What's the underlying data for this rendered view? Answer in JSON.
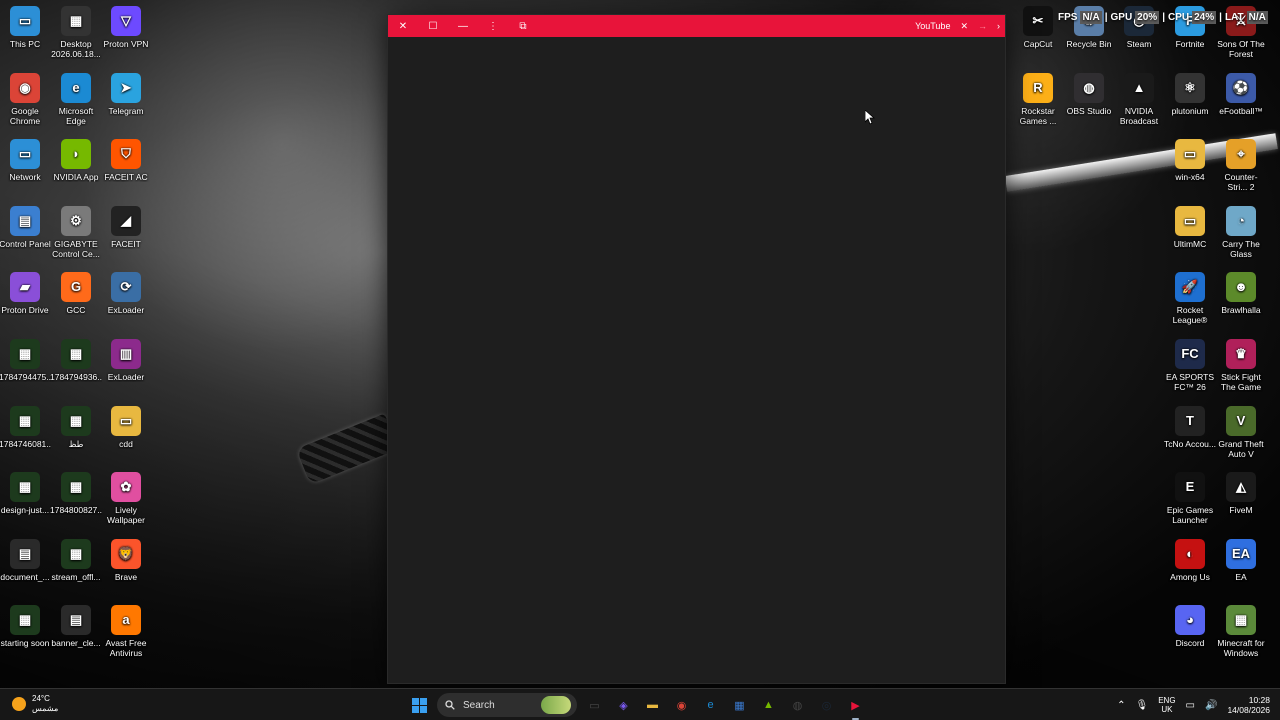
{
  "desktop": {
    "left_icons": [
      {
        "label": "This PC",
        "icon": "this-pc-icon",
        "color": "#2c8fd6",
        "glyph": "▭"
      },
      {
        "label": "Desktop 2026.06.18...",
        "icon": "folder-video-icon",
        "color": "#333333",
        "glyph": "▦"
      },
      {
        "label": "Proton VPN",
        "icon": "proton-vpn-icon",
        "color": "#6d4aff",
        "glyph": "▽"
      },
      {
        "label": "Google Chrome",
        "icon": "chrome-icon",
        "color": "#db4437",
        "glyph": "◉"
      },
      {
        "label": "Microsoft Edge",
        "icon": "edge-icon",
        "color": "#1b8ad3",
        "glyph": "e"
      },
      {
        "label": "Telegram",
        "icon": "telegram-icon",
        "color": "#2aa3df",
        "glyph": "➤"
      },
      {
        "label": "Network",
        "icon": "network-icon",
        "color": "#2c8fd6",
        "glyph": "▭"
      },
      {
        "label": "NVIDIA App",
        "icon": "nvidia-icon",
        "color": "#76b900",
        "glyph": "◗"
      },
      {
        "label": "FACEIT AC",
        "icon": "faceit-ac-icon",
        "color": "#ff5500",
        "glyph": "⛉"
      },
      {
        "label": "Control Panel",
        "icon": "control-panel-icon",
        "color": "#3b7fd0",
        "glyph": "▤"
      },
      {
        "label": "GIGABYTE Control Ce...",
        "icon": "gigabyte-icon",
        "color": "#7a7a7a",
        "glyph": "⚙"
      },
      {
        "label": "FACEIT",
        "icon": "faceit-icon",
        "color": "#222222",
        "glyph": "◢"
      },
      {
        "label": "Proton Drive",
        "icon": "proton-drive-icon",
        "color": "#8a4fd8",
        "glyph": "▰"
      },
      {
        "label": "GCC",
        "icon": "gcc-icon",
        "color": "#ff6a1a",
        "glyph": "G"
      },
      {
        "label": "ExLoader",
        "icon": "exloader-icon",
        "color": "#3a6ea5",
        "glyph": "⟳"
      },
      {
        "label": "1784794475...",
        "icon": "video-thumb-icon",
        "color": "#1d3a1d",
        "glyph": "▦"
      },
      {
        "label": "1784794936...",
        "icon": "video-thumb-icon",
        "color": "#1d3a1d",
        "glyph": "▦"
      },
      {
        "label": "ExLoader",
        "icon": "winrar-icon",
        "color": "#8c2a8c",
        "glyph": "▥"
      },
      {
        "label": "1784746081...",
        "icon": "video-thumb-icon",
        "color": "#1d3a1d",
        "glyph": "▦"
      },
      {
        "label": "طظ",
        "icon": "video-thumb-icon",
        "color": "#1d3a1d",
        "glyph": "▦"
      },
      {
        "label": "cdd",
        "icon": "folder-icon",
        "color": "#e8b840",
        "glyph": "▭"
      },
      {
        "label": "design-just...",
        "icon": "video-thumb-icon",
        "color": "#1d3a1d",
        "glyph": "▦"
      },
      {
        "label": "1784800827...",
        "icon": "video-thumb-icon",
        "color": "#1d3a1d",
        "glyph": "▦"
      },
      {
        "label": "Lively Wallpaper",
        "icon": "lively-icon",
        "color": "#e04fa0",
        "glyph": "✿"
      },
      {
        "label": "document_...",
        "icon": "document-icon",
        "color": "#2a2a2a",
        "glyph": "▤"
      },
      {
        "label": "stream_offl...",
        "icon": "video-thumb-icon",
        "color": "#1d3a1d",
        "glyph": "▦"
      },
      {
        "label": "Brave",
        "icon": "brave-icon",
        "color": "#fb542b",
        "glyph": "🦁"
      },
      {
        "label": "starting soon",
        "icon": "video-thumb-icon",
        "color": "#1d3a1d",
        "glyph": "▦"
      },
      {
        "label": "banner_cle...",
        "icon": "image-thumb-icon",
        "color": "#2a2a2a",
        "glyph": "▤"
      },
      {
        "label": "Avast Free Antivirus",
        "icon": "avast-icon",
        "color": "#ff7800",
        "glyph": "a"
      }
    ],
    "right_icons": [
      {
        "label": "CapCut",
        "icon": "capcut-icon",
        "color": "#111111",
        "glyph": "✂"
      },
      {
        "label": "Recycle Bin",
        "icon": "recycle-bin-icon",
        "color": "#5a7ea8",
        "glyph": "♻"
      },
      {
        "label": "Steam",
        "icon": "steam-icon",
        "color": "#1b2838",
        "glyph": "◎"
      },
      {
        "label": "Fortnite",
        "icon": "fortnite-icon",
        "color": "#2b9be0",
        "glyph": "F"
      },
      {
        "label": "Sons Of The Forest",
        "icon": "sons-forest-icon",
        "color": "#8a1a1a",
        "glyph": "⚔"
      },
      {
        "label": "Rockstar Games ...",
        "icon": "rockstar-icon",
        "color": "#fcaf17",
        "glyph": "R"
      },
      {
        "label": "OBS Studio",
        "icon": "obs-icon",
        "color": "#302e31",
        "glyph": "◍"
      },
      {
        "label": "NVIDIA Broadcast",
        "icon": "nvidia-broadcast-icon",
        "color": "#1a1a1a",
        "glyph": "▲"
      },
      {
        "label": "plutonium",
        "icon": "plutonium-icon",
        "color": "#333333",
        "glyph": "⚛"
      },
      {
        "label": "eFootball™",
        "icon": "efootball-icon",
        "color": "#3c5aa8",
        "glyph": "⚽"
      },
      {
        "label": "win-x64",
        "icon": "folder-icon",
        "color": "#e8b840",
        "glyph": "▭"
      },
      {
        "label": "Counter-Stri... 2",
        "icon": "cs2-icon",
        "color": "#e5a028",
        "glyph": "⌖"
      },
      {
        "label": "UltimMC",
        "icon": "folder-icon",
        "color": "#e8b840",
        "glyph": "▭"
      },
      {
        "label": "Carry The Glass",
        "icon": "carry-glass-icon",
        "color": "#6fa8c8",
        "glyph": "◔"
      },
      {
        "label": "Rocket League®",
        "icon": "rocket-league-icon",
        "color": "#1e6fd0",
        "glyph": "🚀"
      },
      {
        "label": "Brawlhalla",
        "icon": "brawlhalla-icon",
        "color": "#5c8a2a",
        "glyph": "☻"
      },
      {
        "label": "EA SPORTS FC™ 26",
        "icon": "ea-fc-icon",
        "color": "#1e2a4a",
        "glyph": "FC"
      },
      {
        "label": "Stick Fight The Game",
        "icon": "stick-fight-icon",
        "color": "#b0205a",
        "glyph": "♛"
      },
      {
        "label": "TcNo Accou...",
        "icon": "tcno-icon",
        "color": "#222222",
        "glyph": "T"
      },
      {
        "label": "Grand Theft Auto V",
        "icon": "gta5-icon",
        "color": "#4a6a2a",
        "glyph": "V"
      },
      {
        "label": "Epic Games Launcher",
        "icon": "epic-games-icon",
        "color": "#111111",
        "glyph": "E"
      },
      {
        "label": "FiveM",
        "icon": "fivem-icon",
        "color": "#1a1a1a",
        "glyph": "◭"
      },
      {
        "label": "Among Us",
        "icon": "among-us-icon",
        "color": "#c51111",
        "glyph": "◐"
      },
      {
        "label": "EA",
        "icon": "ea-icon",
        "color": "#2f6fe0",
        "glyph": "EA"
      },
      {
        "label": "Discord",
        "icon": "discord-icon",
        "color": "#5865f2",
        "glyph": "◕"
      },
      {
        "label": "Minecraft for Windows",
        "icon": "minecraft-icon",
        "color": "#5b8a3a",
        "glyph": "▦"
      }
    ]
  },
  "overlay": {
    "fps_label": "FPS",
    "fps_value": "N/A",
    "gpu_label": "GPU",
    "gpu_value": "20%",
    "cpu_label": "CPU",
    "cpu_value": "24%",
    "lat_label": "LAT",
    "lat_value": "N/A",
    "sep": "|"
  },
  "window": {
    "title": "YouTube",
    "bar_color": "#e8143a",
    "close_glyph": "✕",
    "maximize_glyph": "☐",
    "minimize_glyph": "—",
    "menu_glyph": "⋮",
    "extension_glyph": "⧉",
    "title_close_glyph": "✕",
    "forward_glyph": "→",
    "more_glyph": "›"
  },
  "taskbar": {
    "weather_temp": "24°C",
    "weather_desc": "مشمس",
    "search_label": "Search",
    "apps": [
      {
        "name": "file-explorer-taskview-icon",
        "glyph": "▭",
        "color": "#4a4a4a"
      },
      {
        "name": "m365-copilot-icon",
        "glyph": "◈",
        "color": "#7a5af0"
      },
      {
        "name": "file-explorer-icon",
        "glyph": "▬",
        "color": "#e8b840"
      },
      {
        "name": "chrome-icon",
        "glyph": "◉",
        "color": "#db4437"
      },
      {
        "name": "edge-icon",
        "glyph": "e",
        "color": "#1b8ad3"
      },
      {
        "name": "ms-store-icon",
        "glyph": "▦",
        "color": "#3a7ad0"
      },
      {
        "name": "nvidia-broadcast-icon",
        "glyph": "▲",
        "color": "#76b900"
      },
      {
        "name": "obs-icon",
        "glyph": "◍",
        "color": "#444444"
      },
      {
        "name": "steam-icon",
        "glyph": "◎",
        "color": "#1b2838"
      },
      {
        "name": "youtube-icon",
        "glyph": "▶",
        "color": "#e8143a"
      }
    ],
    "lang_line1": "ENG",
    "lang_line2": "UK",
    "time": "10:28",
    "date": "14/08/2026"
  }
}
